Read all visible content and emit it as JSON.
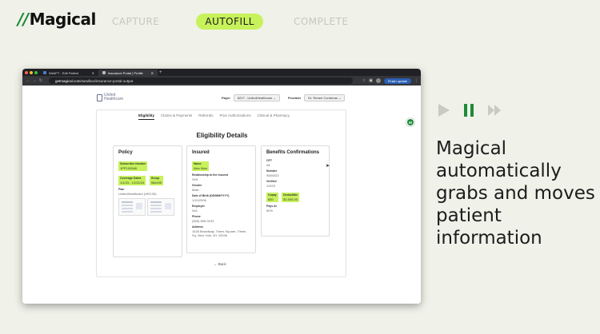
{
  "brand": {
    "logo_mark": "//",
    "logo_text": "Magical"
  },
  "steps": [
    {
      "label": "CAPTURE",
      "active": false
    },
    {
      "label": "AUTOFILL",
      "active": true
    },
    {
      "label": "COMPLETE",
      "active": false
    }
  ],
  "browser": {
    "tabs": [
      {
        "title": "WebPT - Edit Patient"
      },
      {
        "title": "Insurance Portal | Profile"
      }
    ],
    "url_host": "getmagical.com",
    "url_path": "/sandbox/insurance-portal-output",
    "finish_update": "Finish update"
  },
  "portal": {
    "logo_line1": "United",
    "logo_line2": "Healthcare",
    "payer_label": "Payer",
    "payer_value": "8227 - UnitedHealthcare",
    "provider_label": "Provider",
    "provider_value": "Dr. Renee Contreras",
    "nav": [
      "Eligibility",
      "Claims & Payments",
      "Referrals",
      "Prior Authorizations",
      "Clinical & Pharmacy"
    ],
    "title": "Eligibility Details",
    "back": "← Back",
    "policy": {
      "heading": "Policy",
      "subscriber_label": "Subscriber Number",
      "subscriber_value": "1PP192848",
      "coverage_label": "Coverage Dates",
      "coverage_value": "1/1/23 - 12/31/24",
      "group_label": "Group",
      "group_value": "984495",
      "plan_label": "Plan",
      "plan_value": "UnitedHealthcare (HEC30)"
    },
    "insured": {
      "heading": "Insured",
      "name_label": "Name",
      "name_value": "Alex Wan",
      "relationship_label": "Relationship to the Insured",
      "relationship_value": "Self",
      "gender_label": "Gender",
      "gender_value": "Male",
      "dob_label": "Date of Birth (DD/MM/YYYY)",
      "dob_value": "1/10/2006",
      "employer_label": "Employer",
      "employer_value": "N/A",
      "phone_label": "Phone",
      "phone_value": "(555) 555-0193",
      "address_label": "Address",
      "address_value": "1628 Broadway, Times Square, Times Sq, New York, NY 10036"
    },
    "benefits": {
      "heading": "Benefits Confirmations",
      "cpt_label": "CPT",
      "cpt_value": "All",
      "number_label": "Number",
      "number_value": "9484322",
      "verified_label": "Verified",
      "verified_value": "1/9/23",
      "copay_label": "Copay",
      "copay_value": "$30",
      "deductible_label": "Deductible",
      "deductible_value": "$2,000.00",
      "pays_label": "Pays At",
      "pays_value": "80%"
    }
  },
  "extension_badge": "M",
  "tagline": "Magical automatically grabs and moves patient information",
  "colors": {
    "accent_green": "#c7f25b",
    "brand_green": "#1d8a3a",
    "background": "#f0f1e9"
  }
}
